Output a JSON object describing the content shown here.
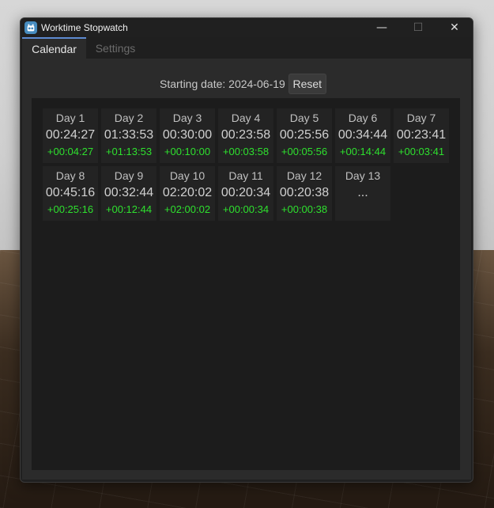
{
  "window": {
    "title": "Worktime Stopwatch"
  },
  "window_controls": {
    "minimize": "—",
    "maximize": "☐",
    "close": "✕"
  },
  "tabs": [
    {
      "label": "Calendar",
      "active": true
    },
    {
      "label": "Settings",
      "active": false
    }
  ],
  "start": {
    "label": "Starting date: 2024-06-19",
    "reset_label": "Reset"
  },
  "days": [
    {
      "label": "Day 1",
      "time": "00:24:27",
      "delta": "+00:04:27"
    },
    {
      "label": "Day 2",
      "time": "01:33:53",
      "delta": "+01:13:53"
    },
    {
      "label": "Day 3",
      "time": "00:30:00",
      "delta": "+00:10:00"
    },
    {
      "label": "Day 4",
      "time": "00:23:58",
      "delta": "+00:03:58"
    },
    {
      "label": "Day 5",
      "time": "00:25:56",
      "delta": "+00:05:56"
    },
    {
      "label": "Day 6",
      "time": "00:34:44",
      "delta": "+00:14:44"
    },
    {
      "label": "Day 7",
      "time": "00:23:41",
      "delta": "+00:03:41"
    },
    {
      "label": "Day 8",
      "time": "00:45:16",
      "delta": "+00:25:16"
    },
    {
      "label": "Day 9",
      "time": "00:32:44",
      "delta": "+00:12:44"
    },
    {
      "label": "Day 10",
      "time": "02:20:02",
      "delta": "+02:00:02"
    },
    {
      "label": "Day 11",
      "time": "00:20:34",
      "delta": "+00:00:34"
    },
    {
      "label": "Day 12",
      "time": "00:20:38",
      "delta": "+00:00:38"
    },
    {
      "label": "Day 13",
      "time": "...",
      "delta": ""
    }
  ],
  "colors": {
    "delta_positive": "#2ee02e",
    "tab_accent": "#5d8ad0",
    "app_icon": "#478cbf"
  }
}
